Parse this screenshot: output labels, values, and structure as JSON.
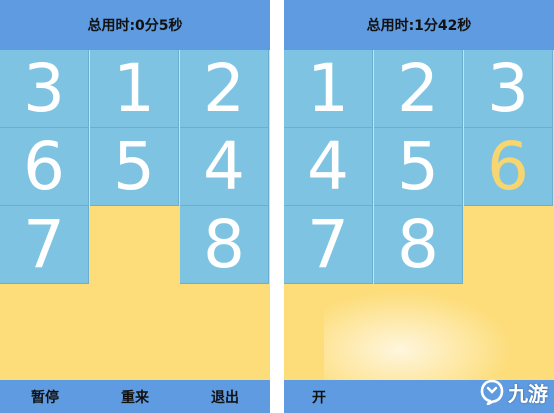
{
  "left": {
    "timer": "总用时:0分5秒",
    "tiles": [
      {
        "label": "3",
        "row": 0,
        "col": 0
      },
      {
        "label": "1",
        "row": 0,
        "col": 1
      },
      {
        "label": "2",
        "row": 0,
        "col": 2
      },
      {
        "label": "6",
        "row": 1,
        "col": 0
      },
      {
        "label": "5",
        "row": 1,
        "col": 1
      },
      {
        "label": "4",
        "row": 1,
        "col": 2
      },
      {
        "label": "7",
        "row": 2,
        "col": 0
      },
      {
        "label": "8",
        "row": 2,
        "col": 2
      }
    ],
    "buttons": {
      "pause": "暂停",
      "restart": "重来",
      "exit": "退出"
    }
  },
  "right": {
    "timer": "总用时:1分42秒",
    "tiles": [
      {
        "label": "1",
        "row": 0,
        "col": 0
      },
      {
        "label": "2",
        "row": 0,
        "col": 1
      },
      {
        "label": "3",
        "row": 0,
        "col": 2
      },
      {
        "label": "4",
        "row": 1,
        "col": 0
      },
      {
        "label": "5",
        "row": 1,
        "col": 1
      },
      {
        "label": "6",
        "row": 1,
        "col": 2,
        "highlight": true
      },
      {
        "label": "7",
        "row": 2,
        "col": 0
      },
      {
        "label": "8",
        "row": 2,
        "col": 1
      }
    ],
    "buttons": {
      "start": "开"
    }
  },
  "watermark": {
    "text": "九游",
    "icon": "jiuyou-logo-icon"
  },
  "colors": {
    "header": "#5f9be0",
    "tile": "#7ec4e2",
    "board": "#fddd7a",
    "tile_text": "#ffffff",
    "highlight_text": "#f7d571"
  }
}
